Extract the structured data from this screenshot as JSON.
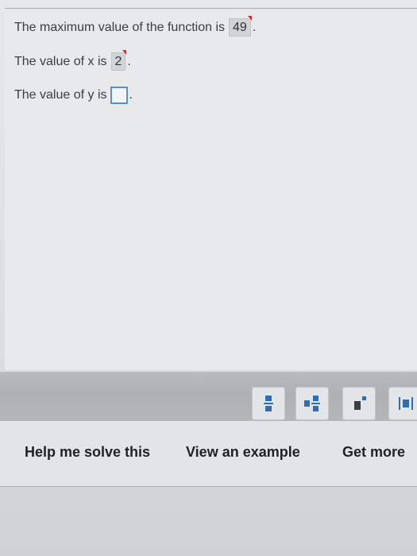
{
  "question": {
    "line1": {
      "text": "The maximum value of the function is",
      "answer": "49",
      "suffix": "."
    },
    "line2": {
      "text": "The value of x is",
      "answer": "2",
      "suffix": "."
    },
    "line3": {
      "text": "The value of y is",
      "suffix": "."
    }
  },
  "toolbar": {
    "tools": [
      {
        "icon": "fraction-icon"
      },
      {
        "icon": "mixed-number-icon"
      },
      {
        "icon": "exponent-icon"
      },
      {
        "icon": "absolute-value-icon"
      }
    ]
  },
  "help_bar": {
    "help_me_solve": "Help me solve this",
    "view_example": "View an example",
    "get_more": "Get more"
  },
  "colors": {
    "answer_flag": "#c8332e",
    "input_border": "#5b8fc9"
  }
}
